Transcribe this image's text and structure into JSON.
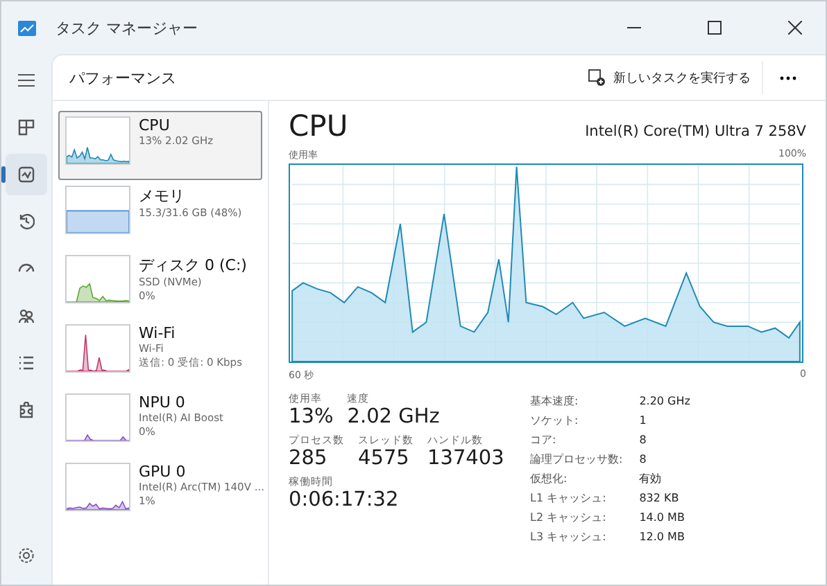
{
  "window": {
    "title": "タスク マネージャー"
  },
  "nav_items": [
    {
      "kind": "processes",
      "selected": false
    },
    {
      "kind": "performance",
      "selected": true
    },
    {
      "kind": "history",
      "selected": false
    },
    {
      "kind": "startup",
      "selected": false
    },
    {
      "kind": "users",
      "selected": false
    },
    {
      "kind": "details",
      "selected": false
    },
    {
      "kind": "services",
      "selected": false
    }
  ],
  "header": {
    "title": "パフォーマンス",
    "run_task_button": "新しいタスクを実行する"
  },
  "devices": [
    {
      "kind": "cpu",
      "name": "CPU",
      "lines": [
        "13%  2.02 GHz"
      ],
      "color": "#1d8ab5",
      "selected": true
    },
    {
      "kind": "memory",
      "name": "メモリ",
      "lines": [
        "15.3/31.6 GB (48%)"
      ],
      "color": "#4a8ad4",
      "selected": false
    },
    {
      "kind": "disk",
      "name": "ディスク 0 (C:)",
      "lines": [
        "SSD (NVMe)",
        "0%"
      ],
      "color": "#5da632",
      "selected": false
    },
    {
      "kind": "wifi",
      "name": "Wi-Fi",
      "lines": [
        "Wi-Fi",
        "送信: 0 受信: 0 Kbps"
      ],
      "color": "#c2386b",
      "selected": false
    },
    {
      "kind": "npu",
      "name": "NPU 0",
      "lines": [
        "Intel(R) AI Boost",
        "0%"
      ],
      "color": "#8a4fc2",
      "selected": false
    },
    {
      "kind": "gpu",
      "name": "GPU 0",
      "lines": [
        "Intel(R) Arc(TM) 140V ...",
        "1%"
      ],
      "color": "#8a4fc2",
      "selected": false
    }
  ],
  "detail": {
    "title": "CPU",
    "model": "Intel(R) Core(TM) Ultra 7 258V",
    "graph_label": "使用率",
    "graph_max": "100%",
    "time_span": "60 秒",
    "time_end": "0",
    "stats": [
      [
        {
          "label": "使用率",
          "value": "13%"
        },
        {
          "label": "速度",
          "value": "2.02 GHz"
        }
      ],
      [
        {
          "label": "プロセス数",
          "value": "285"
        },
        {
          "label": "スレッド数",
          "value": "4575"
        },
        {
          "label": "ハンドル数",
          "value": "137403"
        }
      ],
      [
        {
          "label": "稼働時間",
          "value": "0:06:17:32"
        }
      ]
    ],
    "specs": [
      {
        "key": "基本速度:",
        "value": "2.20 GHz"
      },
      {
        "key": "ソケット:",
        "value": "1"
      },
      {
        "key": "コア:",
        "value": "8"
      },
      {
        "key": "論理プロセッサ数:",
        "value": "8"
      },
      {
        "key": "仮想化:",
        "value": "有効"
      },
      {
        "key": "L1 キャッシュ:",
        "value": "832 KB"
      },
      {
        "key": "L2 キャッシュ:",
        "value": "14.0 MB"
      },
      {
        "key": "L3 キャッシュ:",
        "value": "12.0 MB"
      }
    ]
  }
}
